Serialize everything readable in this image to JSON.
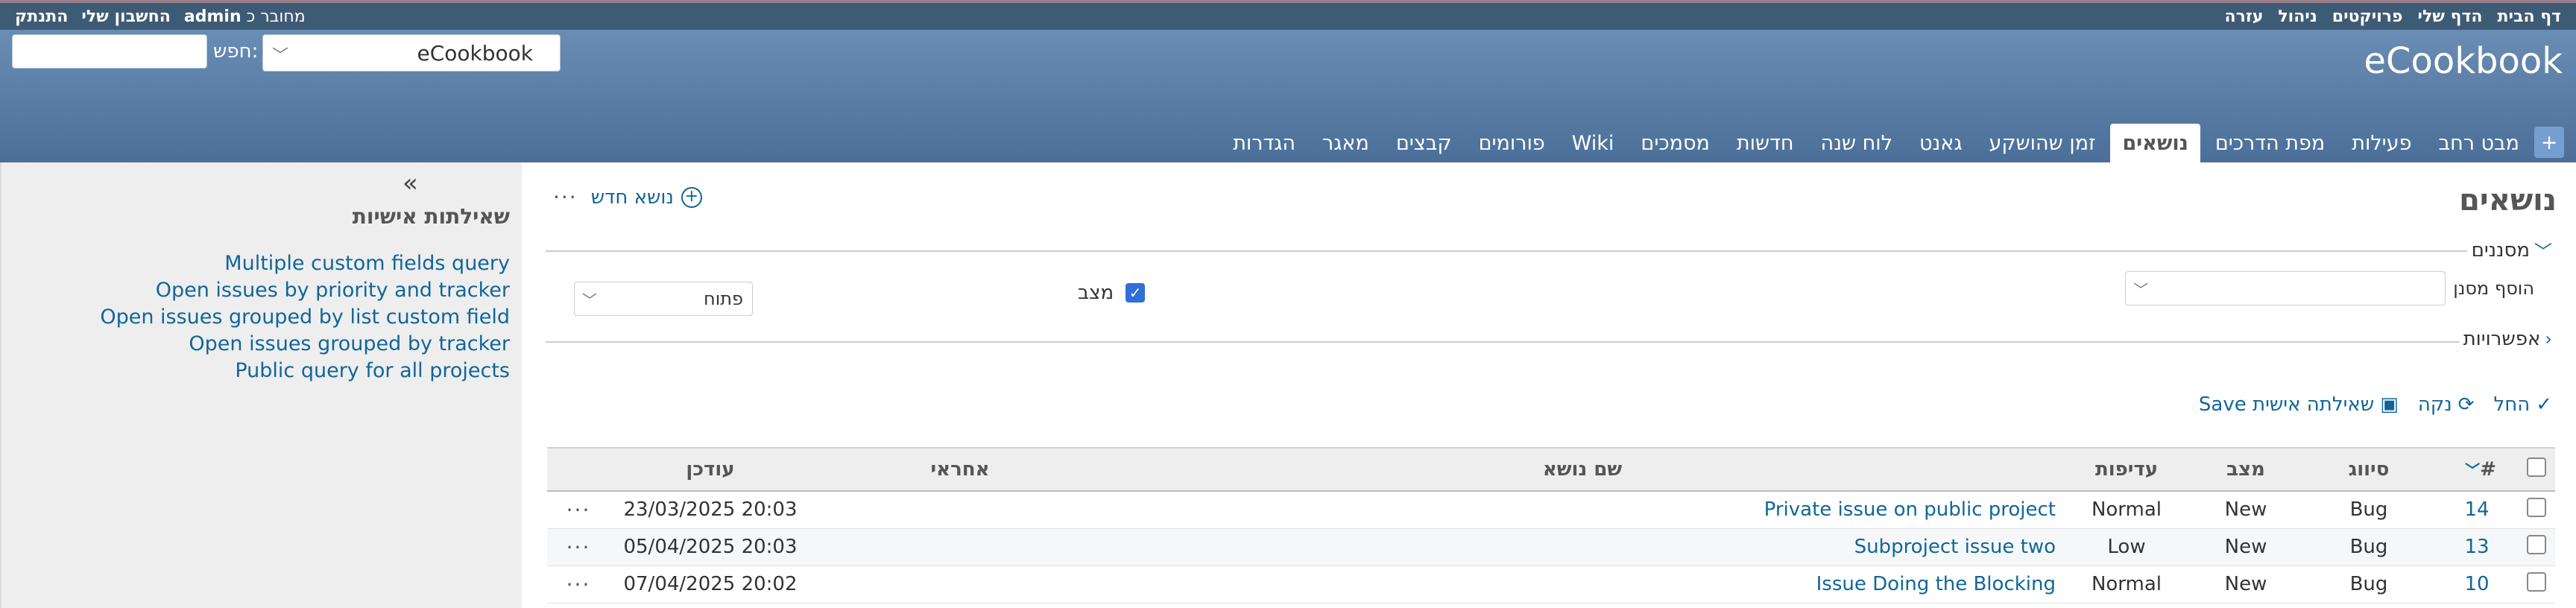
{
  "top_menu": {
    "right": [
      "דף הבית",
      "הדף שלי",
      "פרויקטים",
      "ניהול",
      "עזרה"
    ],
    "logged_as_label": "מחובר כ",
    "logged_as_user": "admin",
    "my_account": "החשבון שלי",
    "logout": "התנתק"
  },
  "header": {
    "site_title": "eCookbook",
    "search_label": "חפש:",
    "search_value": "",
    "project_jump": "eCookbook"
  },
  "main_menu": {
    "new_object": "+",
    "tabs": [
      "מבט רחב",
      "פעילות",
      "מפת הדרכים",
      "נושאים",
      "זמן שהושקע",
      "גאנט",
      "לוח שנה",
      "חדשות",
      "מסמכים",
      "Wiki",
      "פורומים",
      "קבצים",
      "מאגר",
      "הגדרות"
    ],
    "selected_index": 3
  },
  "content": {
    "title": "נושאים",
    "new_issue": "נושא חדש",
    "filters_legend": "מסננים",
    "add_filter_label": "הוסף מסנן",
    "status_filter_label": "מצב",
    "status_filter_checked": true,
    "status_operator": "פתוח",
    "options_legend": "אפשרויות",
    "apply": "החל",
    "clear": "נקה",
    "save_query": "שאילתה אישית Save"
  },
  "table": {
    "headers": {
      "id": "#",
      "tracker": "סיווג",
      "status": "מצב",
      "priority": "עדיפות",
      "subject": "שם נושא",
      "assigned": "אחראי",
      "updated": "עודכן"
    },
    "rows": [
      {
        "id": "14",
        "tracker": "Bug",
        "status": "New",
        "priority": "Normal",
        "subject": "Private issue on public project",
        "assigned": "",
        "updated": "23/03/2025 20:03"
      },
      {
        "id": "13",
        "tracker": "Bug",
        "status": "New",
        "priority": "Low",
        "subject": "Subproject issue two",
        "assigned": "",
        "updated": "05/04/2025 20:03"
      },
      {
        "id": "10",
        "tracker": "Bug",
        "status": "New",
        "priority": "Normal",
        "subject": "Issue Doing the Blocking",
        "assigned": "",
        "updated": "07/04/2025 20:02"
      }
    ]
  },
  "sidebar": {
    "toggle": "«",
    "title": "שאילתות אישיות",
    "queries": [
      "Multiple custom fields query",
      "Open issues by priority and tracker",
      "Open issues grouped by list custom field",
      "Open issues grouped by tracker",
      "Public query for all projects"
    ]
  },
  "colors": {
    "link": "#116699",
    "header_top": "#3e5b76",
    "header_gradient_start": "#6a8db5",
    "header_gradient_end": "#4b6f98"
  }
}
